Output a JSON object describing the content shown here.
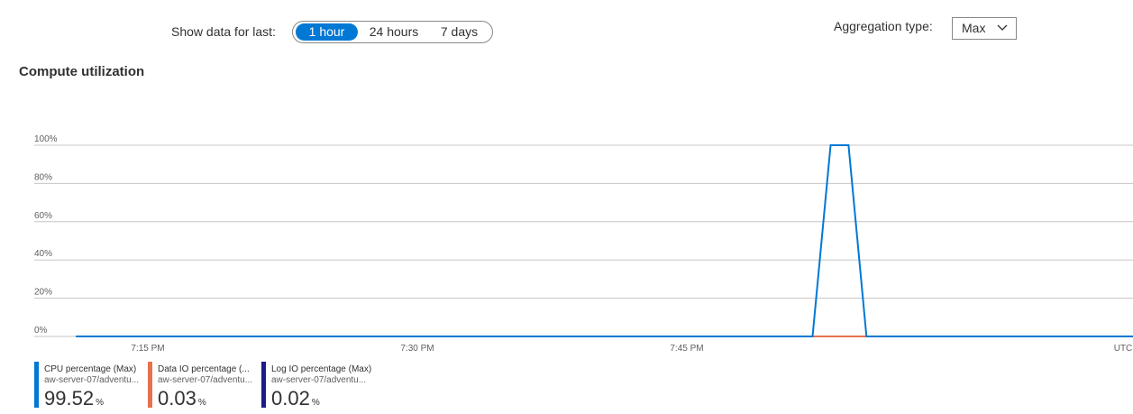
{
  "toolbar": {
    "show_data_label": "Show data for last:",
    "time_options": [
      {
        "label": "1 hour",
        "active": true
      },
      {
        "label": "24 hours",
        "active": false
      },
      {
        "label": "7 days",
        "active": false
      }
    ],
    "aggregation_label": "Aggregation type:",
    "aggregation_value": "Max",
    "chevron_icon": "chevron-down-icon"
  },
  "chart_title": "Compute utilization",
  "chart_data": {
    "type": "line",
    "y_ticks": [
      "100%",
      "80%",
      "60%",
      "40%",
      "20%",
      "0%"
    ],
    "ylim": [
      0,
      100
    ],
    "x_ticks": [
      "7:15 PM",
      "7:30 PM",
      "7:45 PM",
      "UTC"
    ],
    "grid": true,
    "series": [
      {
        "name": "CPU percentage (Max)",
        "color": "#0078d4",
        "x": [
          "7:11 PM",
          "7:52 PM",
          "7:53 PM",
          "7:54 PM",
          "7:55 PM",
          "8:10 PM"
        ],
        "values": [
          0,
          0,
          100,
          100,
          0,
          0
        ]
      },
      {
        "name": "Data IO percentage (Max)",
        "color": "#e8714d",
        "x": [
          "7:11 PM",
          "8:10 PM"
        ],
        "values": [
          0,
          0
        ]
      },
      {
        "name": "Log IO percentage (Max)",
        "color": "#1d1a8a",
        "x": [
          "7:11 PM",
          "8:10 PM"
        ],
        "values": [
          0,
          0
        ]
      }
    ]
  },
  "legend": [
    {
      "name": "CPU percentage (Max)",
      "resource": "aw-server-07/adventu...",
      "value": "99.52",
      "unit": "%",
      "color": "#0078d4"
    },
    {
      "name": "Data IO percentage (...",
      "resource": "aw-server-07/adventu...",
      "value": "0.03",
      "unit": "%",
      "color": "#e8714d"
    },
    {
      "name": "Log IO percentage (Max)",
      "resource": "aw-server-07/adventu...",
      "value": "0.02",
      "unit": "%",
      "color": "#1d1a8a"
    }
  ]
}
